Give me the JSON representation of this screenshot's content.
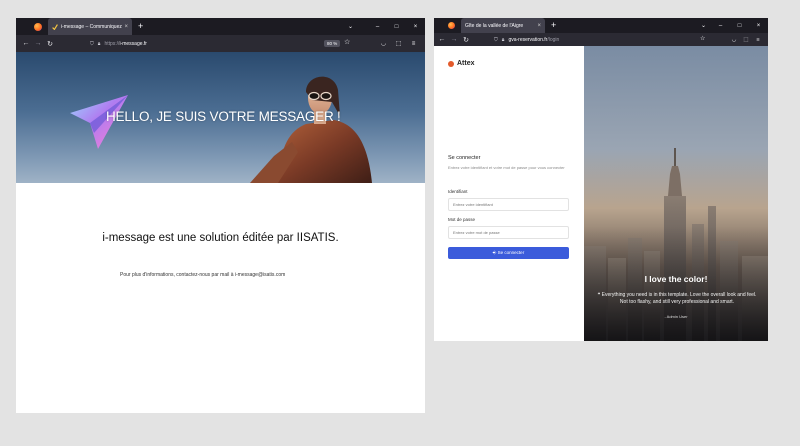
{
  "window1": {
    "tab": {
      "title": "i-message – Communiquez fac",
      "close": "×"
    },
    "new_tab": "+",
    "tab_list": "⌄",
    "controls": {
      "minimize": "–",
      "maximize": "□",
      "close": "×"
    },
    "nav": {
      "back": "←",
      "forward": "→",
      "reload": "↻"
    },
    "url": {
      "scheme": "https://",
      "host": "i-message.fr"
    },
    "zoom": "80 %",
    "hero_text": "HELLO, JE SUIS VOTRE MESSAGER !",
    "main_title": "i-message est une solution éditée par IISATIS.",
    "info_text": "Pour plus d'informations, contactez-nous par mail à i-message@isatis.com"
  },
  "window2": {
    "tab": {
      "title": "Gîte de la vallée de l'Aigre",
      "close": "×"
    },
    "new_tab": "+",
    "tab_list": "⌄",
    "controls": {
      "minimize": "–",
      "maximize": "□",
      "close": "×"
    },
    "nav": {
      "back": "←",
      "forward": "→",
      "reload": "↻"
    },
    "url": {
      "host": "gva-reservation.fr",
      "path": "/login"
    },
    "brand": "Attex",
    "login": {
      "title": "Se connecter",
      "subtitle": "Entrez votre identifiant et votre mot de passe pour vous connecter",
      "username_label": "Identifiant",
      "username_placeholder": "Entrez votre identifiant",
      "password_label": "Mot de passe",
      "password_placeholder": "Entrez votre mot de passe",
      "submit": "Se connecter",
      "submit_icon": "⎆"
    },
    "quote": {
      "title": "I love the color!",
      "text": "❝ Everything you need is in this template. Love the overall look and feel. Not too flashy, and still very professional and smart.",
      "author": "- Admin User"
    }
  },
  "colors": {
    "accent": "#3b5bdb",
    "brand_dot": "#e35a2b",
    "tabbar": "#1c1b22",
    "navbar": "#2b2a33"
  }
}
